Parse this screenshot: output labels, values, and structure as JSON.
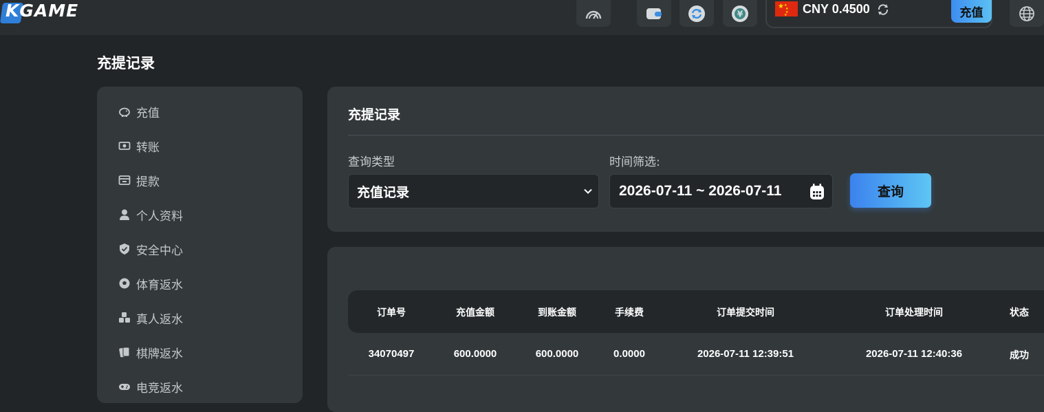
{
  "brand": {
    "logo": "KGAME"
  },
  "topbar": {
    "balance": {
      "flag": "china-flag",
      "currency": "CNY",
      "amount": "0.4500"
    },
    "deposit_label": "充值",
    "icons": [
      "speed-meter-icon",
      "wallet-icon",
      "sync-icon",
      "yuan-coin-icon",
      "globe-icon"
    ]
  },
  "page_title": "充提记录",
  "sidebar": {
    "items": [
      {
        "label": "充值",
        "icon": "piggy-bank-icon"
      },
      {
        "label": "转账",
        "icon": "money-transfer-icon"
      },
      {
        "label": "提款",
        "icon": "withdraw-icon"
      },
      {
        "label": "个人资料",
        "icon": "user-icon"
      },
      {
        "label": "安全中心",
        "icon": "shield-icon"
      },
      {
        "label": "体育返水",
        "icon": "soccer-ball-icon"
      },
      {
        "label": "真人返水",
        "icon": "dice-icon"
      },
      {
        "label": "棋牌返水",
        "icon": "cards-icon"
      },
      {
        "label": "电竞返水",
        "icon": "gamepad-icon"
      }
    ]
  },
  "filter": {
    "title": "充提记录",
    "type_label": "查询类型",
    "type_value": "充值记录",
    "time_label": "时间筛选:",
    "date_range": "2026-07-11 ~ 2026-07-11",
    "query_label": "查询"
  },
  "table": {
    "headers": [
      "订单号",
      "充值金额",
      "到账金额",
      "手续费",
      "订单提交时间",
      "订单处理时间",
      "状态"
    ],
    "rows": [
      [
        "34070497",
        "600.0000",
        "600.0000",
        "0.0000",
        "2026-07-11 12:39:51",
        "2026-07-11 12:40:36",
        "成功"
      ]
    ]
  },
  "colors": {
    "background": "#222527",
    "panel": "#33393b",
    "accent_gradient_start": "#3b82ee",
    "accent_gradient_end": "#5ec6f4"
  }
}
